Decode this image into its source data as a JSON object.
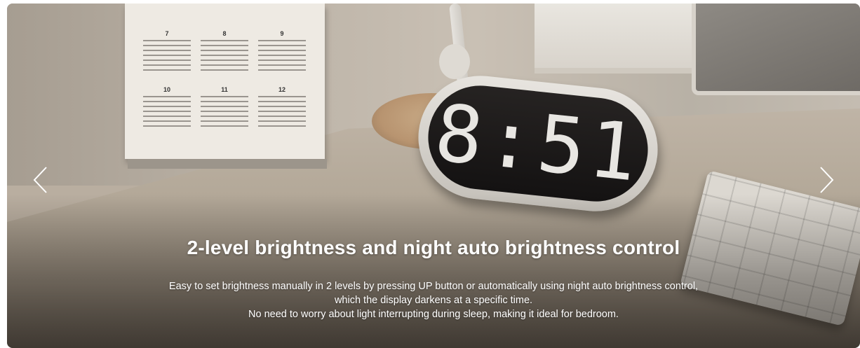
{
  "slide": {
    "headline": "2-level brightness and night auto brightness control",
    "description_lines": [
      "Easy to set brightness manually in 2 levels by pressing UP button or automatically using night auto brightness control,",
      "which the display darkens at a specific time.",
      "No need to worry about light interrupting during sleep, making it ideal for bedroom."
    ]
  },
  "clock_display": "8:51",
  "calendar_months": [
    "7",
    "8",
    "9",
    "10",
    "11",
    "12"
  ],
  "controls": {
    "prev_icon": "chevron-left-icon",
    "next_icon": "chevron-right-icon"
  },
  "colors": {
    "text": "#ffffff",
    "clock_face": "#1a1817",
    "clock_body": "#dcd8d2",
    "wood": "#b89470"
  }
}
